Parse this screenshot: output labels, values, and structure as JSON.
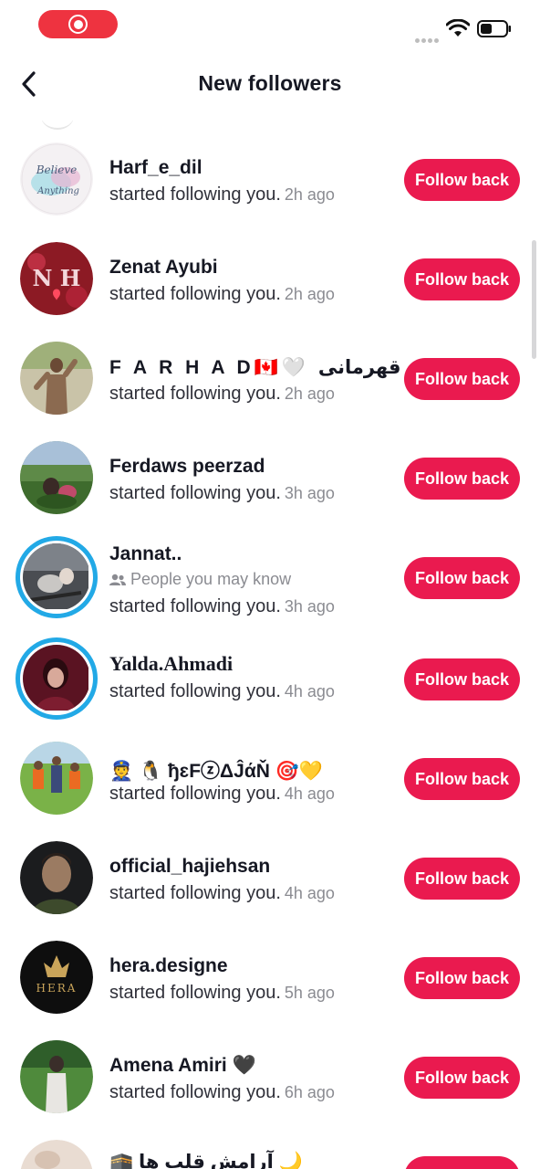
{
  "colors": {
    "accent": "#ea1a4f",
    "record": "#ee3340",
    "story_ring": "#22a9e6"
  },
  "header": {
    "title": "New followers",
    "back_icon": "chevron-left-icon"
  },
  "labels": {
    "follow_back": "Follow back",
    "people_you_may_know": "People you may know"
  },
  "followers": [
    {
      "name": "Harf_e_dil",
      "text": "started following you.",
      "time": "2h ago"
    },
    {
      "name": "Zenat Ayubi",
      "text": "started following you.",
      "time": "2h ago"
    },
    {
      "name": "F A R H A D🇨🇦🤍 قهرمانی",
      "text": "started following you.",
      "time": "2h ago"
    },
    {
      "name": "Ferdaws peerzad",
      "text": "started following you.",
      "time": "3h ago"
    },
    {
      "name": "Jannat..",
      "text": "started following you.",
      "time": "3h ago"
    },
    {
      "name": "Yalda.Ahmadi",
      "text": "started following you.",
      "time": "4h ago"
    },
    {
      "name": "👮 🐧 ђɛFⓩΔĴάŇ 🎯💛",
      "text": "started following you.",
      "time": "4h ago"
    },
    {
      "name": "official_hajiehsan",
      "text": "started following you.",
      "time": "4h ago"
    },
    {
      "name": "hera.designe",
      "text": "started following you.",
      "time": "5h ago"
    },
    {
      "name": "Amena Amiri 🖤",
      "text": "started following you.",
      "time": "6h ago"
    },
    {
      "name": "🕋 آرامش قلب ها 🌙",
      "text": "",
      "time": ""
    }
  ],
  "avatars": {
    "believe_text_1": "Believe",
    "believe_text_2": "Anything",
    "nh_text": "N H",
    "hera_text": "HERA"
  }
}
